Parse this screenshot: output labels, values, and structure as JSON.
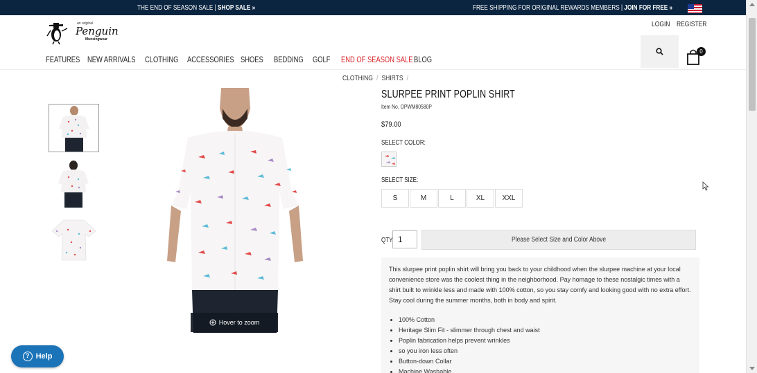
{
  "topbar": {
    "left_text": "THE END OF SEASON SALE | ",
    "left_link": "SHOP SALE »",
    "right_text": "FREE SHIPPING FOR ORIGINAL REWARDS MEMBERS | ",
    "right_link": "JOIN FOR FREE »",
    "flag_icon": "us-flag-icon"
  },
  "brand": {
    "tagline": "an original",
    "name": "Penguin",
    "sub": "Munsingwear"
  },
  "account": {
    "login": "LOGIN",
    "register": "REGISTER"
  },
  "nav": {
    "items": [
      {
        "label": "FEATURES"
      },
      {
        "label": "NEW ARRIVALS"
      },
      {
        "label": "CLOTHING"
      },
      {
        "label": "ACCESSORIES"
      },
      {
        "label": "SHOES"
      },
      {
        "label": "BEDDING"
      },
      {
        "label": "GOLF"
      },
      {
        "label": "END OF SEASON SALE",
        "color": "#d9262b"
      },
      {
        "label": "BLOG"
      }
    ]
  },
  "cart": {
    "count": "0"
  },
  "breadcrumb": [
    "CLOTHING",
    "SHIRTS"
  ],
  "product": {
    "name": "SLURPEE PRINT POPLIN SHIRT",
    "item_no": "Item No. OPWM80580P",
    "price": "$79.00",
    "select_color_label": "SELECT COLOR:",
    "select_size_label": "SELECT SIZE:",
    "sizes": [
      "S",
      "M",
      "L",
      "XL",
      "XXL"
    ],
    "qty_label": "QTY",
    "qty_value": "1",
    "add_button": "Please Select Size and Color Above",
    "zoom_hint": "Hover to zoom",
    "description": "This slurpee print poplin shirt will bring you back to your childhood when the slurpee machine at your local convenience store was the coolest thing in the neighborhood. Pay homage to these nostalgic times with a shirt built to wrinkle less and made with 100% cotton, so you stay comfy and looking good with no extra effort. Stay cool during the summer months, both in body and spirit.",
    "features": [
      "100% Cotton",
      "Heritage Slim Fit - slimmer through chest and waist",
      "Poplin fabrication helps prevent wrinkles",
      "so you iron less often",
      "Button-down Collar",
      "Machine Washable"
    ]
  },
  "help": {
    "label": "Help"
  },
  "colors": {
    "topbar": "#0b2540",
    "sale": "#d9262b",
    "help": "#1c74b8"
  }
}
